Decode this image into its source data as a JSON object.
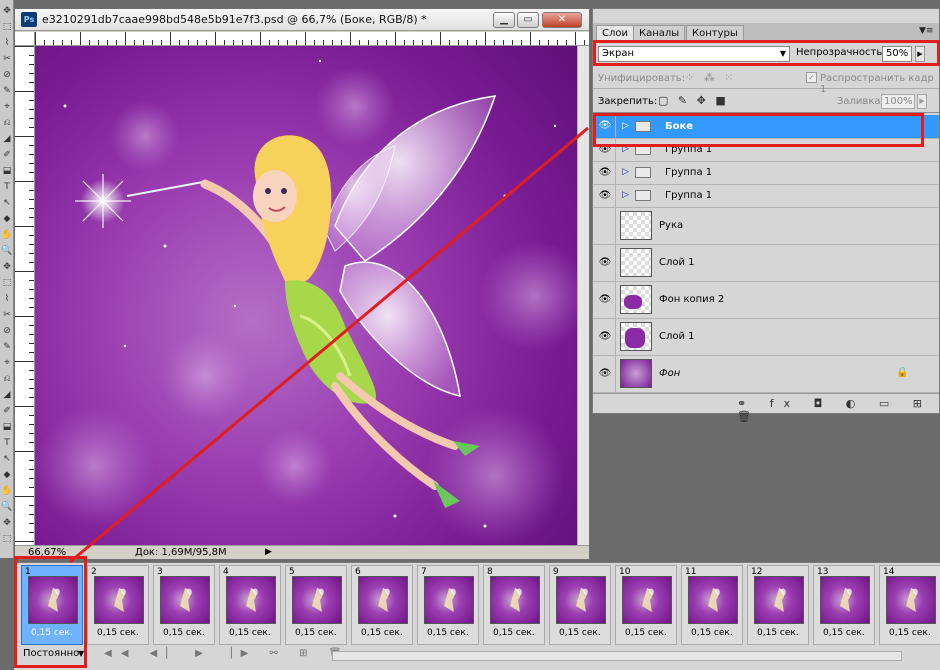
{
  "document": {
    "app_icon": "Ps",
    "title": "e3210291db7caae998bd548e5b91e7f3.psd @ 66,7% (Боке, RGB/8) *",
    "zoom": "66,67%",
    "doc_size": "Док: 1,69M/95,8M",
    "window_buttons": {
      "minimize": "▁",
      "maximize": "▭",
      "close": "✕"
    }
  },
  "layers_panel": {
    "tabs": [
      "Слои",
      "Каналы",
      "Контуры"
    ],
    "active_tab": "Слои",
    "blend_mode": "Экран",
    "opacity_label": "Непрозрачность:",
    "opacity_value": "50%",
    "unify_label": "Унифицировать:",
    "propagate_label": "Распространить кадр 1",
    "lock_label": "Закрепить:",
    "fill_label": "Заливка:",
    "fill_value": "100%",
    "layers": [
      {
        "name": "Боке",
        "type": "group",
        "visible": true,
        "selected": true
      },
      {
        "name": "Группа 1",
        "type": "group",
        "visible": true,
        "selected": false
      },
      {
        "name": "Группа 1",
        "type": "group",
        "visible": true,
        "selected": false
      },
      {
        "name": "Группа 1",
        "type": "group",
        "visible": true,
        "selected": false
      },
      {
        "name": "Рука",
        "type": "layer",
        "visible": false,
        "selected": false
      },
      {
        "name": "Слой 1",
        "type": "layer",
        "visible": true,
        "selected": false
      },
      {
        "name": "Фон копия 2",
        "type": "layer",
        "visible": true,
        "selected": false
      },
      {
        "name": "Слой 1",
        "type": "layer",
        "visible": true,
        "selected": false
      },
      {
        "name": "Фон",
        "type": "background",
        "visible": true,
        "selected": false,
        "locked": true
      }
    ]
  },
  "animation_panel": {
    "loop": "Постоянно",
    "frames": [
      {
        "num": "1",
        "delay": "0,15 сек."
      },
      {
        "num": "2",
        "delay": "0,15 сек."
      },
      {
        "num": "3",
        "delay": "0,15 сек."
      },
      {
        "num": "4",
        "delay": "0,15 сек."
      },
      {
        "num": "5",
        "delay": "0,15 сек."
      },
      {
        "num": "6",
        "delay": "0,15 сек."
      },
      {
        "num": "7",
        "delay": "0,15 сек."
      },
      {
        "num": "8",
        "delay": "0,15 сек."
      },
      {
        "num": "9",
        "delay": "0,15 сек."
      },
      {
        "num": "10",
        "delay": "0,15 сек."
      },
      {
        "num": "11",
        "delay": "0,15 сек."
      },
      {
        "num": "12",
        "delay": "0,15 сек."
      },
      {
        "num": "13",
        "delay": "0,15 сек."
      },
      {
        "num": "14",
        "delay": "0,15 сек."
      }
    ]
  },
  "colors": {
    "selection": "#3399ff",
    "annotation_red": "#e11d1d",
    "canvas_purple": "#8a2aa5"
  }
}
